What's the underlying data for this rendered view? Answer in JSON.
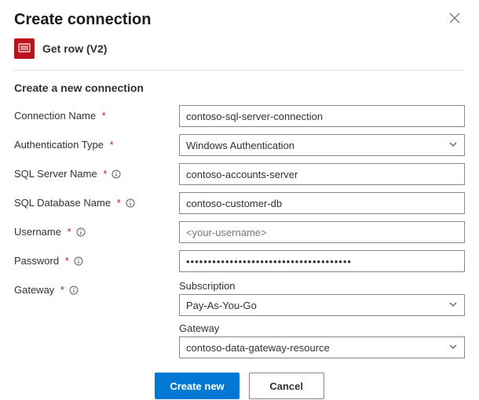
{
  "header": {
    "title": "Create connection"
  },
  "operation": {
    "name": "Get row (V2)"
  },
  "section": {
    "heading": "Create a new connection"
  },
  "fields": {
    "connectionName": {
      "label": "Connection Name",
      "value": "contoso-sql-server-connection"
    },
    "authType": {
      "label": "Authentication Type",
      "value": "Windows Authentication"
    },
    "serverName": {
      "label": "SQL Server Name",
      "value": "contoso-accounts-server"
    },
    "dbName": {
      "label": "SQL Database Name",
      "value": "contoso-customer-db"
    },
    "username": {
      "label": "Username",
      "placeholder": "<your-username>"
    },
    "password": {
      "label": "Password",
      "value": "••••••••••••••••••••••••••••••••••••••"
    },
    "gateway": {
      "label": "Gateway",
      "subscriptionLabel": "Subscription",
      "subscriptionValue": "Pay-As-You-Go",
      "gatewayLabel": "Gateway",
      "gatewayValue": "contoso-data-gateway-resource"
    }
  },
  "footer": {
    "primary": "Create new",
    "secondary": "Cancel"
  }
}
